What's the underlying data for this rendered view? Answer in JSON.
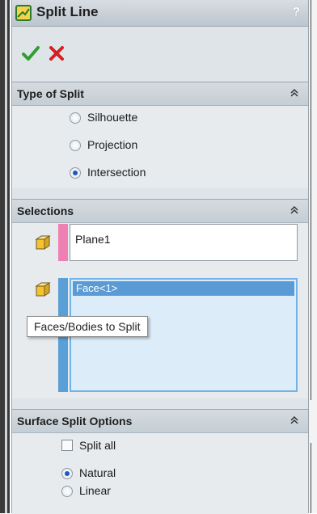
{
  "title": "Split Line",
  "help_label": "?",
  "groups": {
    "type_of_split": {
      "title": "Type of Split",
      "options": [
        {
          "label": "Silhouette",
          "selected": false
        },
        {
          "label": "Projection",
          "selected": false
        },
        {
          "label": "Intersection",
          "selected": true
        }
      ]
    },
    "selections": {
      "title": "Selections",
      "splitting_tool": "Plane1",
      "faces_list": [
        "Face<1>"
      ],
      "tooltip": "Faces/Bodies to Split"
    },
    "surface_split_options": {
      "title": "Surface Split Options",
      "split_all_label": "Split all",
      "split_all_checked": false,
      "options": [
        {
          "label": "Natural",
          "selected": true
        },
        {
          "label": "Linear",
          "selected": false
        }
      ]
    }
  },
  "colors": {
    "splitting_tool_bar": "#ef80b2",
    "faces_bar": "#5a9fd6",
    "selected_item": "#5b9bd5"
  }
}
